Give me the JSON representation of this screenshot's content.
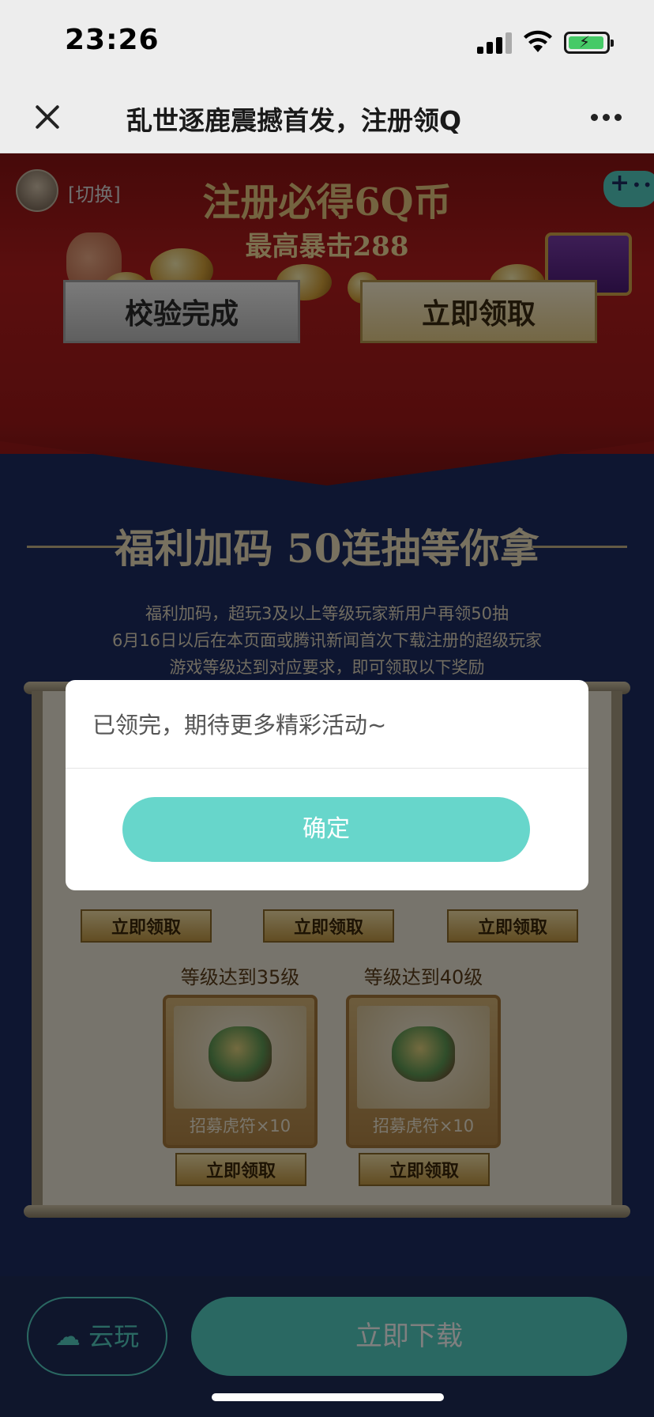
{
  "status": {
    "time": "23:26"
  },
  "nav": {
    "title": "乱世逐鹿震撼首发，注册领Q"
  },
  "header": {
    "switch_label": "[切换]"
  },
  "banner": {
    "title": "注册必得6Q币",
    "subtitle": "最高暴击288",
    "verify_label": "校验完成",
    "claim_label": "立即领取"
  },
  "section": {
    "title": "福利加码 50连抽等你拿",
    "desc_lines": [
      "福利加码，超玩3及以上等级玩家新用户再领50抽",
      "6月16日以后在本页面或腾讯新闻首次下载注册的超级玩家",
      "游戏等级达到对应要求，即可领取以下奖励"
    ]
  },
  "rewards": {
    "row1_buttons": [
      "立即领取",
      "立即领取",
      "立即领取"
    ],
    "row2": [
      {
        "level": "等级达到35级",
        "item": "招募虎符×10",
        "button": "立即领取"
      },
      {
        "level": "等级达到40级",
        "item": "招募虎符×10",
        "button": "立即领取"
      }
    ]
  },
  "footer": {
    "cloud_label": "云玩",
    "download_label": "立即下载"
  },
  "dialog": {
    "message": "已领完，期待更多精彩活动~",
    "confirm_label": "确定"
  },
  "colors": {
    "accent": "#67d6cb",
    "page_bg": "#1c2d63",
    "banner_red": "#b61d1d"
  }
}
